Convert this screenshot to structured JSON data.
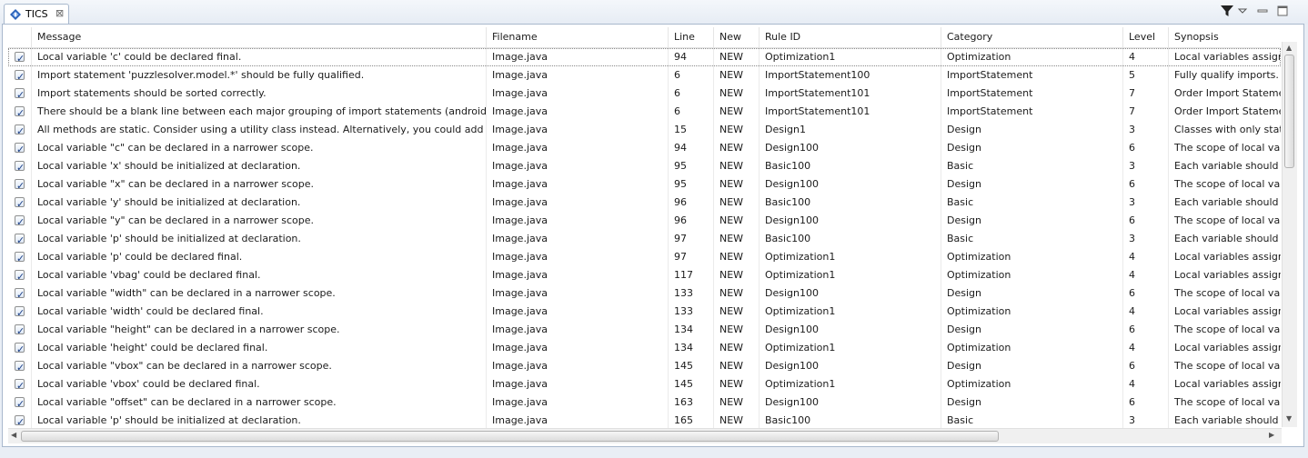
{
  "view": {
    "tab_title": "TICS",
    "tab_close": "⊠",
    "icons": [
      "tics-icon",
      "filter-icon",
      "view-menu-icon",
      "minimize-icon",
      "maximize-icon"
    ]
  },
  "table": {
    "columns": [
      "",
      "Message",
      "Filename",
      "Line",
      "New",
      "Rule ID",
      "Category",
      "Level",
      "Synopsis"
    ],
    "rows": [
      {
        "checked": true,
        "message": "Local variable 'c' could be declared final.",
        "filename": "Image.java",
        "line": "94",
        "new": "NEW",
        "rule_id": "Optimization1",
        "category": "Optimization",
        "level": "4",
        "synopsis": "Local variables assigned only once..."
      },
      {
        "checked": true,
        "message": "Import statement 'puzzlesolver.model.*' should be fully qualified.",
        "filename": "Image.java",
        "line": "6",
        "new": "NEW",
        "rule_id": "ImportStatement100",
        "category": "ImportStatement",
        "level": "5",
        "synopsis": "Fully qualify imports."
      },
      {
        "checked": true,
        "message": "Import statements should be sorted correctly.",
        "filename": "Image.java",
        "line": "6",
        "new": "NEW",
        "rule_id": "ImportStatement101",
        "category": "ImportStatement",
        "level": "7",
        "synopsis": "Order Import Statements..."
      },
      {
        "checked": true,
        "message": "There should be a blank line between each major grouping of import statements (android,...",
        "filename": "Image.java",
        "line": "6",
        "new": "NEW",
        "rule_id": "ImportStatement101",
        "category": "ImportStatement",
        "level": "7",
        "synopsis": "Order Import Statements..."
      },
      {
        "checked": true,
        "message": "All methods are static.  Consider using a utility class instead. Alternatively, you could add a...",
        "filename": "Image.java",
        "line": "15",
        "new": "NEW",
        "rule_id": "Design1",
        "category": "Design",
        "level": "3",
        "synopsis": "Classes with only static..."
      },
      {
        "checked": true,
        "message": "Local variable \"c\" can be declared in a narrower scope.",
        "filename": "Image.java",
        "line": "94",
        "new": "NEW",
        "rule_id": "Design100",
        "category": "Design",
        "level": "6",
        "synopsis": "The scope of local variables..."
      },
      {
        "checked": true,
        "message": "Local variable 'x' should be initialized at declaration.",
        "filename": "Image.java",
        "line": "95",
        "new": "NEW",
        "rule_id": "Basic100",
        "category": "Basic",
        "level": "3",
        "synopsis": "Each variable should have..."
      },
      {
        "checked": true,
        "message": "Local variable \"x\" can be declared in a narrower scope.",
        "filename": "Image.java",
        "line": "95",
        "new": "NEW",
        "rule_id": "Design100",
        "category": "Design",
        "level": "6",
        "synopsis": "The scope of local variables..."
      },
      {
        "checked": true,
        "message": "Local variable 'y' should be initialized at declaration.",
        "filename": "Image.java",
        "line": "96",
        "new": "NEW",
        "rule_id": "Basic100",
        "category": "Basic",
        "level": "3",
        "synopsis": "Each variable should have..."
      },
      {
        "checked": true,
        "message": "Local variable \"y\" can be declared in a narrower scope.",
        "filename": "Image.java",
        "line": "96",
        "new": "NEW",
        "rule_id": "Design100",
        "category": "Design",
        "level": "6",
        "synopsis": "The scope of local variables..."
      },
      {
        "checked": true,
        "message": "Local variable 'p' should be initialized at declaration.",
        "filename": "Image.java",
        "line": "97",
        "new": "NEW",
        "rule_id": "Basic100",
        "category": "Basic",
        "level": "3",
        "synopsis": "Each variable should have..."
      },
      {
        "checked": true,
        "message": "Local variable 'p' could be declared final.",
        "filename": "Image.java",
        "line": "97",
        "new": "NEW",
        "rule_id": "Optimization1",
        "category": "Optimization",
        "level": "4",
        "synopsis": "Local variables assigned only once..."
      },
      {
        "checked": true,
        "message": "Local variable 'vbag' could be declared final.",
        "filename": "Image.java",
        "line": "117",
        "new": "NEW",
        "rule_id": "Optimization1",
        "category": "Optimization",
        "level": "4",
        "synopsis": "Local variables assigned only once..."
      },
      {
        "checked": true,
        "message": "Local variable \"width\" can be declared in a narrower scope.",
        "filename": "Image.java",
        "line": "133",
        "new": "NEW",
        "rule_id": "Design100",
        "category": "Design",
        "level": "6",
        "synopsis": "The scope of local variables..."
      },
      {
        "checked": true,
        "message": "Local variable 'width' could be declared final.",
        "filename": "Image.java",
        "line": "133",
        "new": "NEW",
        "rule_id": "Optimization1",
        "category": "Optimization",
        "level": "4",
        "synopsis": "Local variables assigned only once..."
      },
      {
        "checked": true,
        "message": "Local variable \"height\" can be declared in a narrower scope.",
        "filename": "Image.java",
        "line": "134",
        "new": "NEW",
        "rule_id": "Design100",
        "category": "Design",
        "level": "6",
        "synopsis": "The scope of local variables..."
      },
      {
        "checked": true,
        "message": "Local variable 'height' could be declared final.",
        "filename": "Image.java",
        "line": "134",
        "new": "NEW",
        "rule_id": "Optimization1",
        "category": "Optimization",
        "level": "4",
        "synopsis": "Local variables assigned only once..."
      },
      {
        "checked": true,
        "message": "Local variable \"vbox\" can be declared in a narrower scope.",
        "filename": "Image.java",
        "line": "145",
        "new": "NEW",
        "rule_id": "Design100",
        "category": "Design",
        "level": "6",
        "synopsis": "The scope of local variables..."
      },
      {
        "checked": true,
        "message": "Local variable 'vbox' could be declared final.",
        "filename": "Image.java",
        "line": "145",
        "new": "NEW",
        "rule_id": "Optimization1",
        "category": "Optimization",
        "level": "4",
        "synopsis": "Local variables assigned only once..."
      },
      {
        "checked": true,
        "message": "Local variable \"offset\" can be declared in a narrower scope.",
        "filename": "Image.java",
        "line": "163",
        "new": "NEW",
        "rule_id": "Design100",
        "category": "Design",
        "level": "6",
        "synopsis": "The scope of local variables..."
      },
      {
        "checked": true,
        "message": "Local variable 'p' should be initialized at declaration.",
        "filename": "Image.java",
        "line": "165",
        "new": "NEW",
        "rule_id": "Basic100",
        "category": "Basic",
        "level": "3",
        "synopsis": "Each variable should have..."
      }
    ]
  },
  "scrollbars": {
    "vertical_position": 0.0,
    "horizontal_position": 0.0
  },
  "colors": {
    "accent": "#2a62b9",
    "checkmark": "#1a3f86",
    "frame_border": "#a8b8cd"
  }
}
